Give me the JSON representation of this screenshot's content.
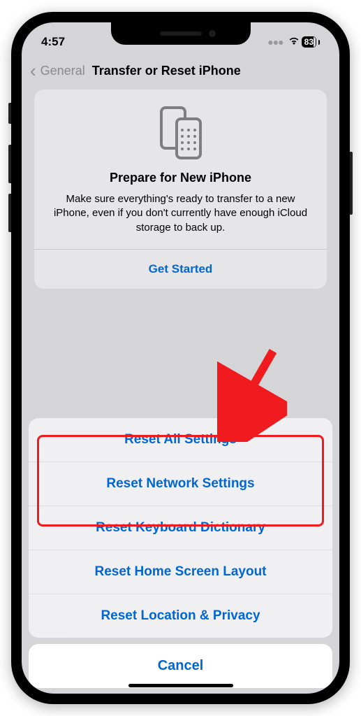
{
  "status": {
    "time": "4:57",
    "battery": "83"
  },
  "nav": {
    "back_label": "General",
    "title": "Transfer or Reset iPhone"
  },
  "card": {
    "title": "Prepare for New iPhone",
    "description": "Make sure everything's ready to transfer to a new iPhone, even if you don't currently have enough iCloud storage to back up.",
    "cta": "Get Started"
  },
  "sheet": {
    "items": [
      "Reset All Settings",
      "Reset Network Settings",
      "Reset Keyboard Dictionary",
      "Reset Home Screen Layout",
      "Reset Location & Privacy"
    ],
    "cancel": "Cancel"
  }
}
